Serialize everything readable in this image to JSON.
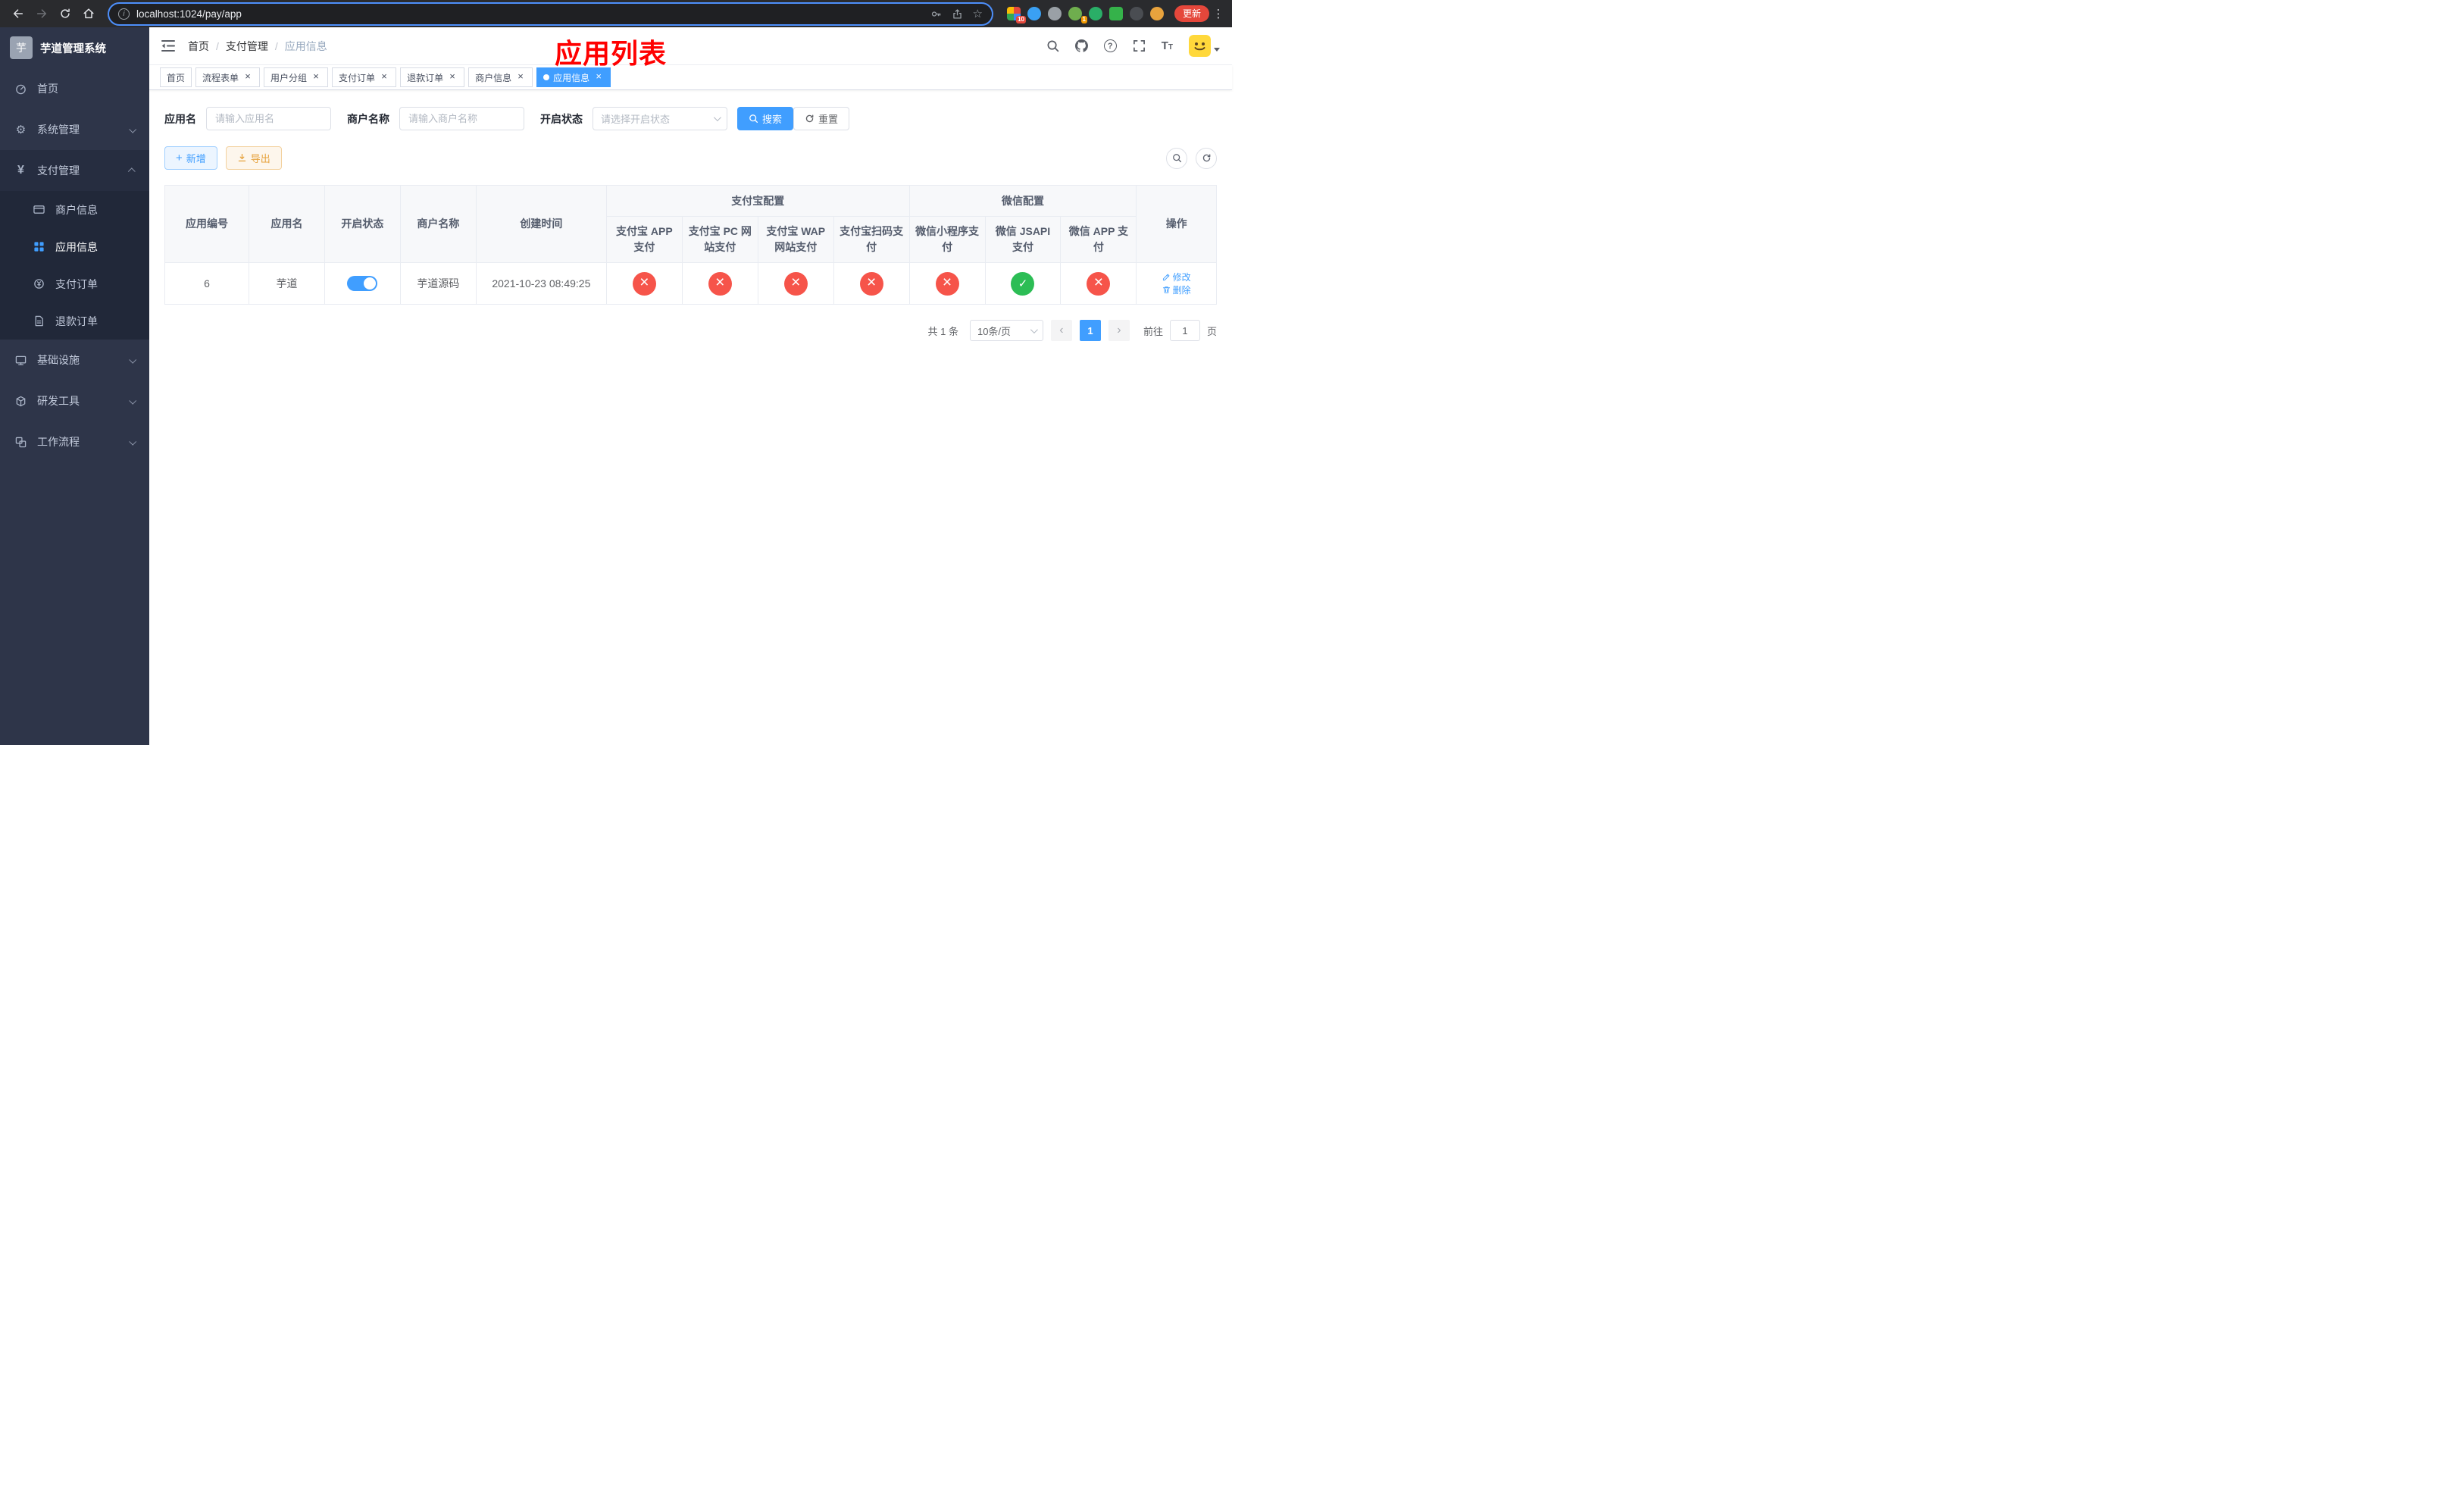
{
  "browser": {
    "url": "localhost:1024/pay/app",
    "update_button": "更新",
    "extension_badge": "10",
    "profile_badge": "1"
  },
  "icons": {
    "gear": "⚙",
    "yen": "¥",
    "star": "☆",
    "kebab": "⋮",
    "plus": "+",
    "info": "i",
    "question": "?",
    "font_large": "T",
    "font_small": "T",
    "close": "×",
    "prev_arrow": "‹",
    "next_arrow": "›",
    "logo_initial": "芋"
  },
  "sidebar": {
    "app_title": "芋道管理系统",
    "menu": [
      {
        "label": "首页"
      },
      {
        "label": "系统管理"
      },
      {
        "label": "支付管理"
      },
      {
        "label": "基础设施"
      },
      {
        "label": "研发工具"
      },
      {
        "label": "工作流程"
      }
    ],
    "payment_submenu": [
      {
        "label": "商户信息"
      },
      {
        "label": "应用信息"
      },
      {
        "label": "支付订单"
      },
      {
        "label": "退款订单"
      }
    ]
  },
  "header": {
    "breadcrumb": [
      "首页",
      "支付管理",
      "应用信息"
    ],
    "overlay_title": "应用列表"
  },
  "tabs": [
    {
      "label": "首页"
    },
    {
      "label": "流程表单"
    },
    {
      "label": "用户分组"
    },
    {
      "label": "支付订单"
    },
    {
      "label": "退款订单"
    },
    {
      "label": "商户信息"
    },
    {
      "label": "应用信息"
    }
  ],
  "filters": {
    "app_name_label": "应用名",
    "app_name_placeholder": "请输入应用名",
    "merchant_label": "商户名称",
    "merchant_placeholder": "请输入商户名称",
    "status_label": "开启状态",
    "status_placeholder": "请选择开启状态",
    "search_label": "搜索",
    "reset_label": "重置"
  },
  "toolbar": {
    "add_label": "新增",
    "export_label": "导出"
  },
  "table": {
    "groups": {
      "alipay": "支付宝配置",
      "wechat": "微信配置"
    },
    "columns": [
      "应用编号",
      "应用名",
      "开启状态",
      "商户名称",
      "创建时间",
      "支付宝 APP 支付",
      "支付宝 PC 网站支付",
      "支付宝 WAP 网站支付",
      "支付宝扫码支付",
      "微信小程序支付",
      "微信 JSAPI 支付",
      "微信 APP 支付",
      "操作"
    ],
    "row": {
      "app_id": "6",
      "app_name": "芋道",
      "enabled": true,
      "merchant_name": "芋道源码",
      "create_time": "2021-10-23 08:49:25",
      "configs": [
        false,
        false,
        false,
        false,
        false,
        true,
        false
      ]
    },
    "actions": {
      "edit": "修改",
      "delete": "删除"
    }
  },
  "pagination": {
    "total": "共 1 条",
    "page_size": "10条/页",
    "page": "1",
    "goto_label": "前往",
    "goto_unit": "页",
    "goto_value": "1"
  }
}
